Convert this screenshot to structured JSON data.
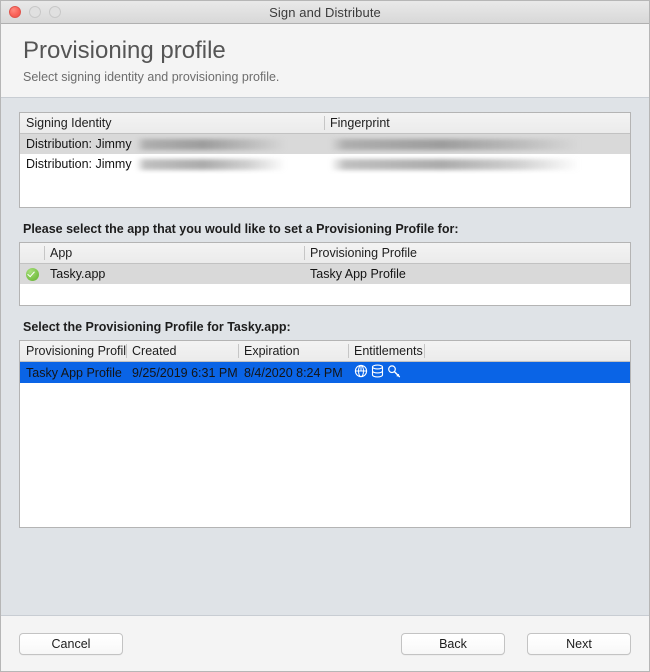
{
  "window": {
    "title": "Sign and Distribute",
    "traffic_lights": [
      "close",
      "minimize",
      "zoom"
    ]
  },
  "header": {
    "title": "Provisioning profile",
    "subtitle": "Select signing identity and provisioning profile."
  },
  "identity_table": {
    "columns": [
      "Signing Identity",
      "Fingerprint"
    ],
    "rows": [
      {
        "identity": "Distribution: Jimmy",
        "identity_redacted": true,
        "fingerprint": "",
        "fingerprint_redacted": true
      },
      {
        "identity": "Distribution: Jimmy",
        "identity_redacted": true,
        "fingerprint": "",
        "fingerprint_redacted": true
      }
    ]
  },
  "app_section": {
    "label": "Please select the app that you would like to set a Provisioning Profile for:",
    "columns": [
      "",
      "App",
      "Provisioning Profile"
    ],
    "rows": [
      {
        "checked": true,
        "check_icon": "green-check-icon",
        "app": "Tasky.app",
        "profile": "Tasky App Profile"
      }
    ]
  },
  "profile_section": {
    "label": "Select the Provisioning Profile for Tasky.app:",
    "columns": [
      "Provisioning Profile",
      "Created",
      "Expiration",
      "Entitlements",
      ""
    ],
    "rows": [
      {
        "profile": "Tasky App Profile",
        "created": "9/25/2019 6:31 PM",
        "expiration": "8/4/2020 8:24 PM",
        "entitlement_icons": [
          "network-globe-icon",
          "database-stack-icon",
          "key-icon"
        ],
        "selected": true
      }
    ]
  },
  "footer": {
    "cancel_label": "Cancel",
    "back_label": "Back",
    "next_label": "Next"
  },
  "colors": {
    "selection_blue": "#0a64e6",
    "check_green": "#7cc34a",
    "body_background": "#dfe3e7",
    "chrome_background": "#f4f4f4"
  }
}
